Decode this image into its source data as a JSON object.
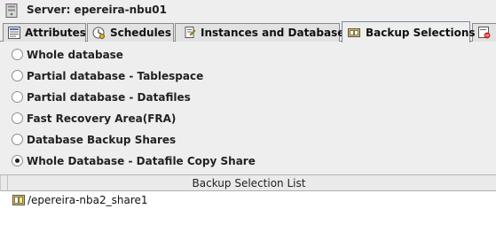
{
  "server": {
    "label": "Server: epereira-nbu01"
  },
  "tabs": [
    {
      "label": "Attributes",
      "icon": "attributes-icon"
    },
    {
      "label": "Schedules",
      "icon": "schedules-icon"
    },
    {
      "label": "Instances and Databases",
      "icon": "instances-icon"
    },
    {
      "label": "Backup Selections",
      "icon": "backup-selections-icon",
      "active": true
    }
  ],
  "options": [
    {
      "label": "Whole database",
      "checked": false
    },
    {
      "label": "Partial database - Tablespace",
      "checked": false
    },
    {
      "label": "Partial database - Datafiles",
      "checked": false
    },
    {
      "label": "Fast Recovery Area(FRA)",
      "checked": false
    },
    {
      "label": "Database Backup Shares",
      "checked": false
    },
    {
      "label": "Whole Database - Datafile Copy Share",
      "checked": true
    }
  ],
  "selection_list": {
    "header": "Backup Selection List",
    "items": [
      "/epereira-nba2_share1"
    ]
  }
}
